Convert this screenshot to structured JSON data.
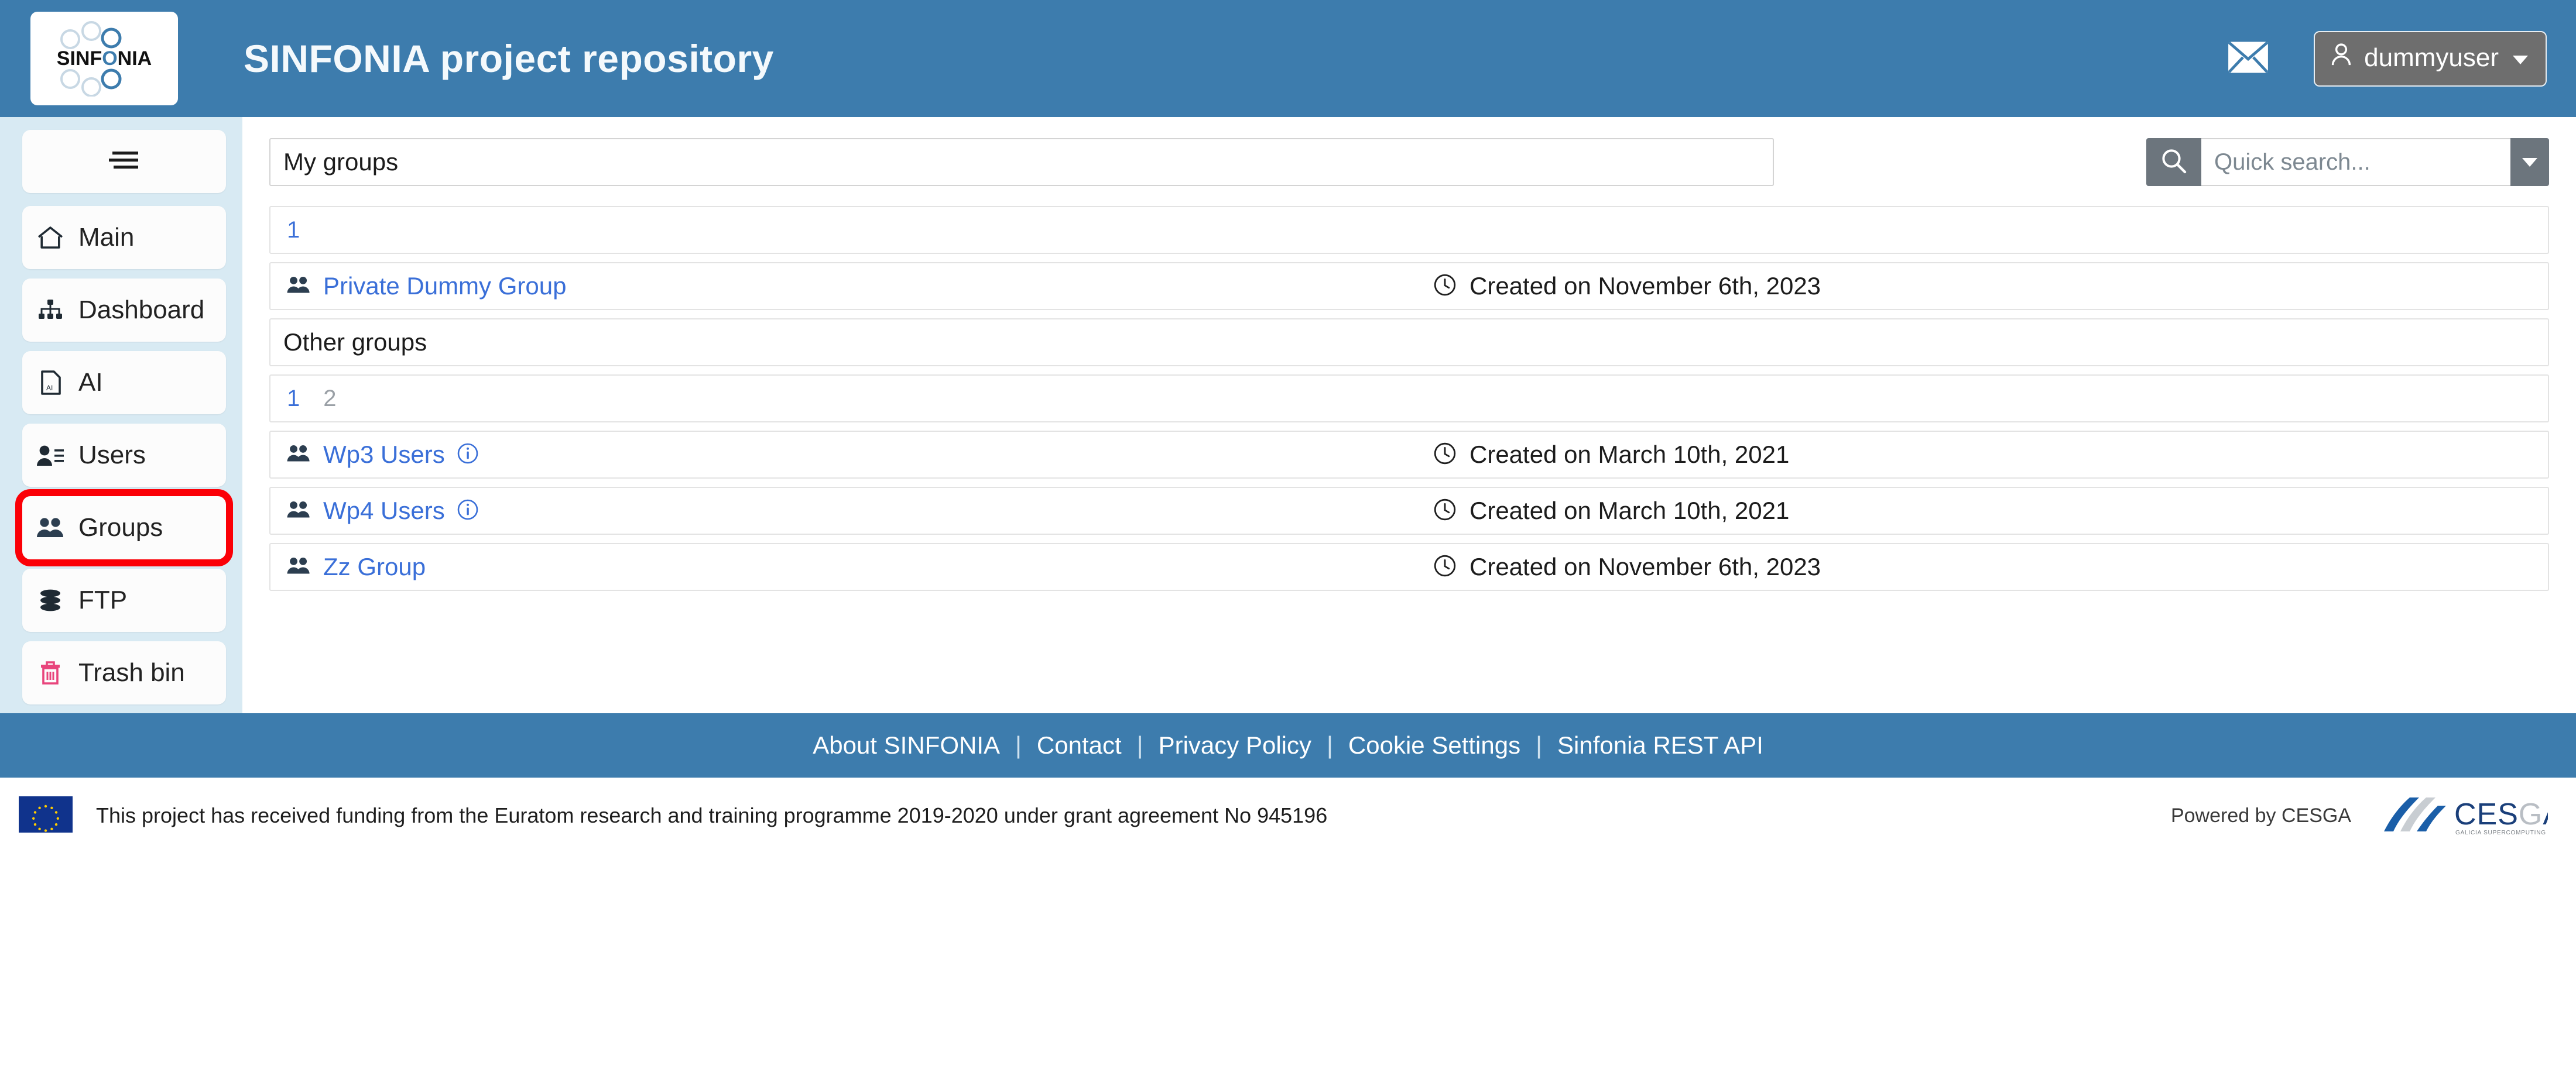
{
  "header": {
    "title": "SINFONIA project repository",
    "logo_text": "SINFONIA",
    "mail_icon": "envelope-icon",
    "user": {
      "label": "dummyuser",
      "icon": "user-icon",
      "caret": "caret-down-icon"
    }
  },
  "sidebar": {
    "toggle": {
      "icon": "hamburger-menu-icon"
    },
    "items": [
      {
        "label": "Main",
        "icon": "home-icon"
      },
      {
        "label": "Dashboard",
        "icon": "sitemap-icon"
      },
      {
        "label": "AI",
        "icon": "file-ai-icon"
      },
      {
        "label": "Users",
        "icon": "user-list-icon"
      },
      {
        "label": "Groups",
        "icon": "people-group-icon"
      },
      {
        "label": "FTP",
        "icon": "database-stack-icon"
      },
      {
        "label": "Trash bin",
        "icon": "trash-bin-icon"
      }
    ],
    "highlighted_item": "Groups",
    "highlight_color": "#fb0007"
  },
  "main": {
    "my_groups": {
      "panel_label": "My groups",
      "pagination": [
        {
          "label": "1",
          "active": true
        }
      ],
      "rows": [
        {
          "name": "Private Dummy Group",
          "icon": "people-group-icon",
          "info_icon": false,
          "date": "Created on November 6th, 2023",
          "date_icon": "clock-icon"
        }
      ]
    },
    "other_groups": {
      "panel_label": "Other groups",
      "pagination": [
        {
          "label": "1",
          "active": true
        },
        {
          "label": "2",
          "active": false
        }
      ],
      "rows": [
        {
          "name": "Wp3 Users",
          "icon": "people-group-icon",
          "info_icon": true,
          "date": "Created on March 10th, 2021",
          "date_icon": "clock-icon"
        },
        {
          "name": "Wp4 Users",
          "icon": "people-group-icon",
          "info_icon": true,
          "date": "Created on March 10th, 2021",
          "date_icon": "clock-icon"
        },
        {
          "name": "Zz Group",
          "icon": "people-group-icon",
          "info_icon": false,
          "date": "Created on November 6th, 2023",
          "date_icon": "clock-icon"
        }
      ]
    }
  },
  "search": {
    "placeholder": "Quick search...",
    "value": "",
    "icon": "search-icon",
    "dropdown_icon": "caret-down-icon"
  },
  "footer": {
    "links": [
      "About SINFONIA",
      "Contact",
      "Privacy Policy",
      "Cookie Settings",
      "Sinfonia REST API"
    ],
    "separator": "|",
    "funding_text": "This project has received funding from the Euratom research and training programme 2019-2020 under grant agreement No 945196",
    "eu_flag_icon": "eu-flag-icon",
    "powered_by": "Powered by CESGA",
    "cesga_name": "CESGA",
    "cesga_tagline": "GALICIA SUPERCOMPUTING CENTER"
  },
  "colors": {
    "header_blue": "#3d7cad",
    "sidebar_blue": "#d8eaf3",
    "link_blue": "#3a6fd8",
    "highlight_red": "#fb0007",
    "button_grey": "#6c757d"
  }
}
